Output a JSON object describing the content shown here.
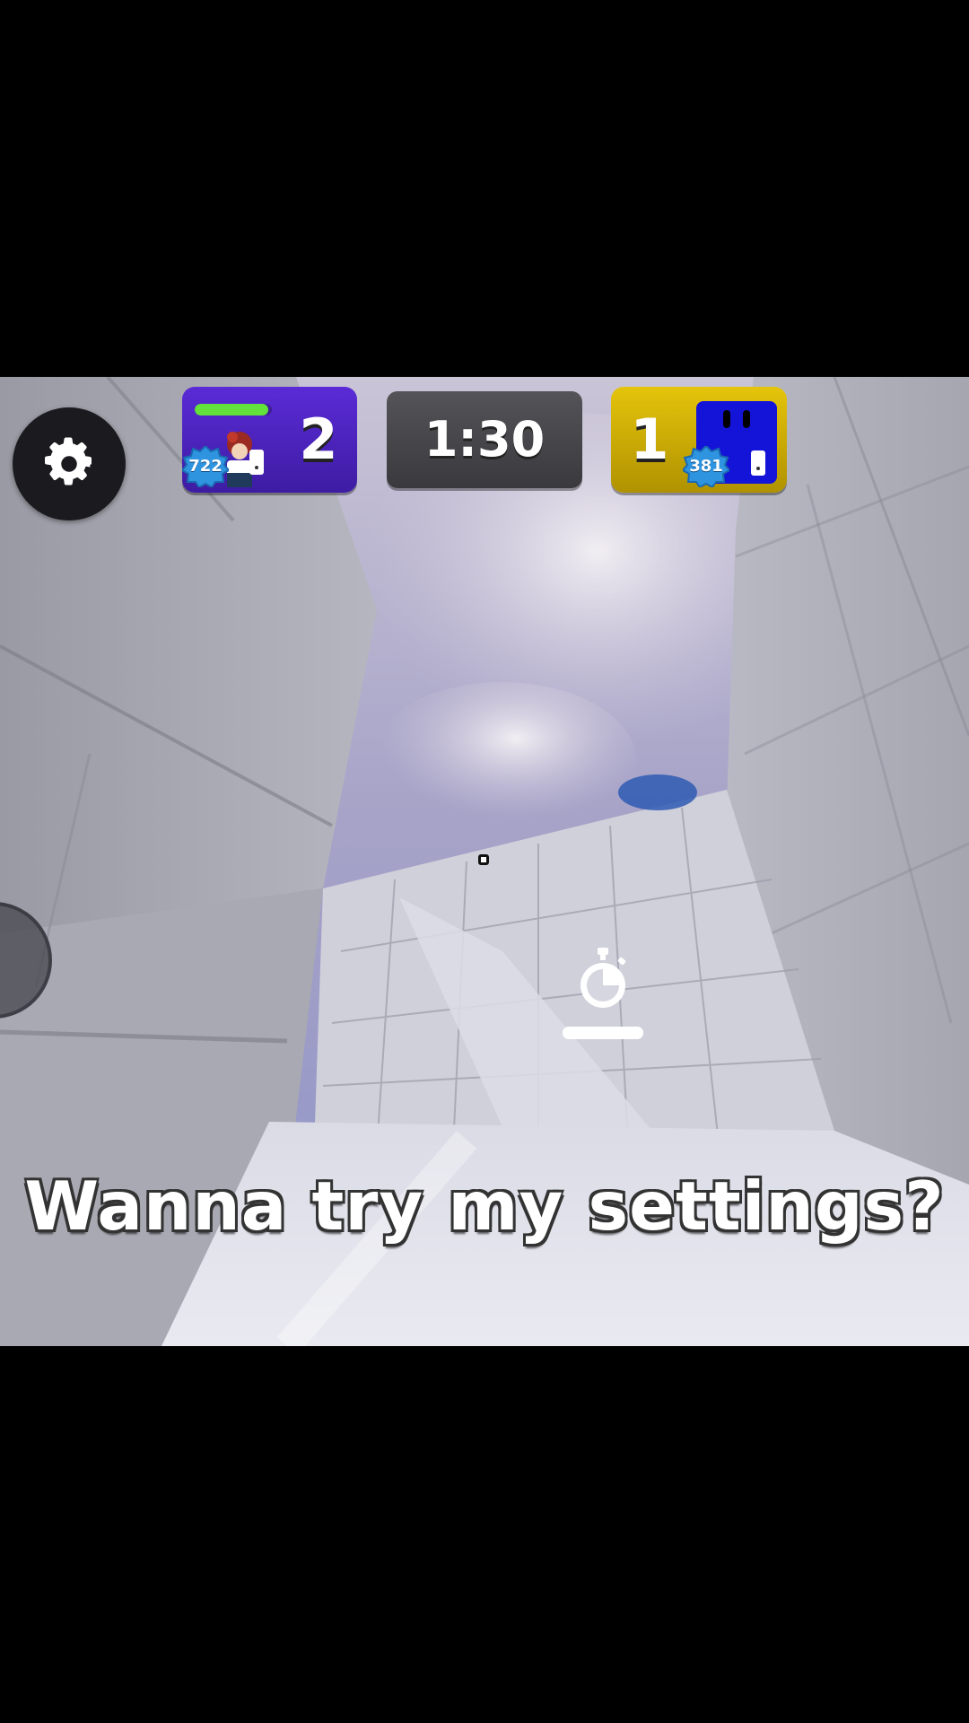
{
  "hud": {
    "timer": "1:30",
    "team_left": {
      "score": "2",
      "level": "722",
      "health": 0.95,
      "color": "#4a22c0"
    },
    "team_right": {
      "score": "1",
      "level": "381",
      "color": "#d6b400"
    },
    "settings_icon": "gear-icon",
    "ability_icon": "stopwatch-icon",
    "ability_charge": 1.0
  },
  "caption": {
    "text": "Wanna try my settings?"
  }
}
